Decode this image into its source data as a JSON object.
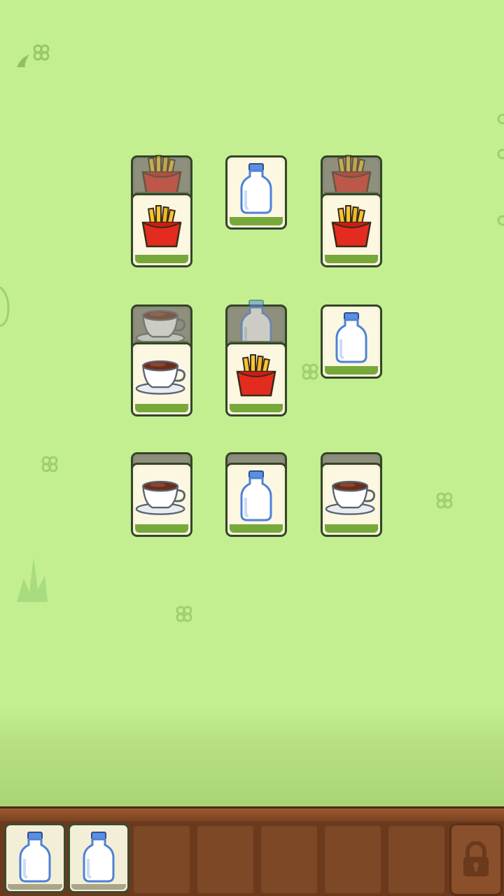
{
  "game": {
    "board": {
      "tiles": [
        {
          "row": 1,
          "col": 1,
          "item": "fries",
          "state": "covered"
        },
        {
          "row": 1,
          "col": 1,
          "item": "fries",
          "state": "open"
        },
        {
          "row": 1,
          "col": 2,
          "item": "milk-bottle",
          "state": "open"
        },
        {
          "row": 1,
          "col": 3,
          "item": "fries",
          "state": "covered"
        },
        {
          "row": 1,
          "col": 3,
          "item": "fries",
          "state": "open"
        },
        {
          "row": 2,
          "col": 1,
          "item": "coffee-cup",
          "state": "covered"
        },
        {
          "row": 2,
          "col": 1,
          "item": "coffee-cup",
          "state": "open"
        },
        {
          "row": 2,
          "col": 2,
          "item": "milk-bottle",
          "state": "covered"
        },
        {
          "row": 2,
          "col": 2,
          "item": "fries",
          "state": "open"
        },
        {
          "row": 2,
          "col": 3,
          "item": "milk-bottle",
          "state": "open"
        },
        {
          "row": 3,
          "col": 1,
          "item": "coffee-cup",
          "state": "covered"
        },
        {
          "row": 3,
          "col": 1,
          "item": "coffee-cup",
          "state": "open"
        },
        {
          "row": 3,
          "col": 2,
          "item": "milk-bottle",
          "state": "covered"
        },
        {
          "row": 3,
          "col": 2,
          "item": "milk-bottle",
          "state": "open"
        },
        {
          "row": 3,
          "col": 3,
          "item": "coffee-cup",
          "state": "covered"
        },
        {
          "row": 3,
          "col": 3,
          "item": "coffee-cup",
          "state": "open"
        }
      ]
    },
    "tray": {
      "slots": [
        "milk-bottle",
        "milk-bottle",
        null,
        null,
        null,
        null,
        null
      ],
      "locked_slot_icon": "lock-icon"
    },
    "colors": {
      "background": "#c3ef91",
      "tile_face": "#fbf7e1",
      "tile_bottom": "#77a83a",
      "tray_wood": "#6b3a1d"
    }
  }
}
